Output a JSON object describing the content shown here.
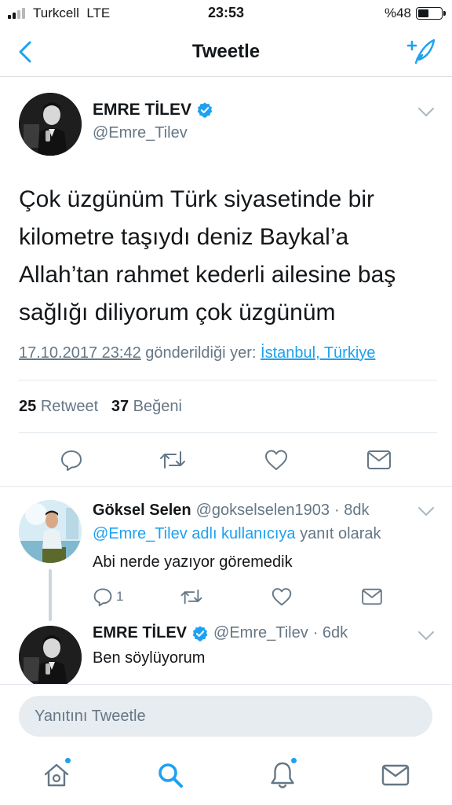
{
  "status_bar": {
    "carrier": "Turkcell",
    "network": "LTE",
    "time": "23:53",
    "battery": "%48",
    "battery_level": 0.48
  },
  "nav": {
    "title": "Tweetle",
    "back_icon": "chevron-left-icon",
    "compose_icon": "compose-tweet-icon",
    "accent": "#1da1f2"
  },
  "main_tweet": {
    "author_name": "EMRE TİLEV",
    "author_handle": "@Emre_Tilev",
    "verified": true,
    "text": "Çok üzgünüm Türk siyasetinde bir kilometre taşıydı deniz Baykal’a Allah’tan rahmet kederli ailesine baş sağlığı diliyorum çok üzgünüm",
    "timestamp": "17.10.2017 23:42",
    "location_prefix": "gönderildiği yer:",
    "location": "İstanbul, Türkiye",
    "retweet_count": "25",
    "retweet_label": "Retweet",
    "like_count": "37",
    "like_label": "Beğeni"
  },
  "replies": [
    {
      "author_name": "Göksel Selen",
      "author_handle": "@gokselselen1903",
      "time": "· 8dk",
      "replying_mention": "@Emre_Tilev adlı kullanıcıya",
      "replying_suffix": "yanıt olarak",
      "text": "Abi nerde yazıyor göremedik",
      "reply_count": "1"
    },
    {
      "author_name": "EMRE TİLEV",
      "author_handle": "@Emre_Tilev",
      "time": "· 6dk",
      "verified": true,
      "text": "Ben söylüyorum"
    }
  ],
  "compose": {
    "placeholder": "Yanıtını Tweetle"
  },
  "tab_bar": {
    "items": [
      "home-icon",
      "search-icon",
      "notifications-icon",
      "messages-icon"
    ]
  },
  "colors": {
    "accent": "#1da1f2",
    "secondary_text": "#657786",
    "divider": "#e1e8ed"
  }
}
